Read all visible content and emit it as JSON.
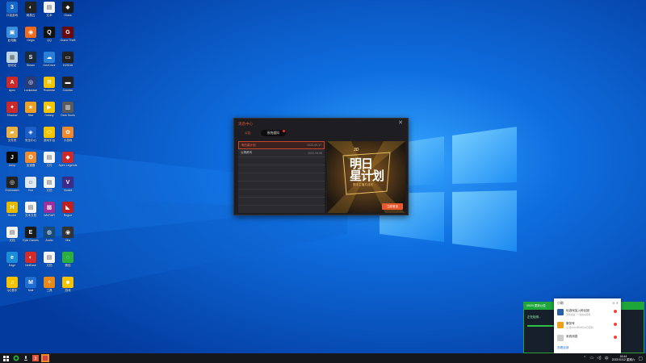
{
  "desktop_icons": [
    {
      "label": "口袋游戏",
      "color": "#1669c9",
      "glyph": "3"
    },
    {
      "label": "网易云",
      "color": "#222222",
      "glyph": "◐"
    },
    {
      "label": "文本",
      "color": "#f2f2f2",
      "glyph": "▤"
    },
    {
      "label": "Glass",
      "color": "#1a1a1a",
      "glyph": "◆"
    },
    {
      "label": "此电脑",
      "color": "#3b8edb",
      "glyph": "▣"
    },
    {
      "label": "Origin",
      "color": "#f26b1d",
      "glyph": "◉"
    },
    {
      "label": "QQ",
      "color": "#111111",
      "glyph": "Q"
    },
    {
      "label": "Grand Theft",
      "color": "#6a0a0a",
      "glyph": "G"
    },
    {
      "label": "回收站",
      "color": "#bcd4ea",
      "glyph": "▦"
    },
    {
      "label": "Steam",
      "color": "#1b2a3d",
      "glyph": "S"
    },
    {
      "label": "OneDrive",
      "color": "#2a7fd6",
      "glyph": "☁"
    },
    {
      "label": "NVIDIA",
      "color": "#222222",
      "glyph": "▭"
    },
    {
      "label": "Apex",
      "color": "#cc2a2a",
      "glyph": "A"
    },
    {
      "label": "Lockdown",
      "color": "#2a3c78",
      "glyph": "◎"
    },
    {
      "label": "Rockstar",
      "color": "#f4c400",
      "glyph": "R"
    },
    {
      "label": "Counter",
      "color": "#222222",
      "glyph": "▬"
    },
    {
      "label": "Shadow",
      "color": "#cc2a2a",
      "glyph": "✦"
    },
    {
      "label": "Star",
      "color": "#f0a020",
      "glyph": "★"
    },
    {
      "label": "Galaxy",
      "color": "#f4c400",
      "glyph": "▶"
    },
    {
      "label": "Dark Souls",
      "color": "#5a5a5a",
      "glyph": "▥"
    },
    {
      "label": "文件夹",
      "color": "#e9b143",
      "glyph": "▰"
    },
    {
      "label": "安全中心",
      "color": "#1b5ec8",
      "glyph": "◈"
    },
    {
      "label": "游戏平台",
      "color": "#f4c400",
      "glyph": "⚇"
    },
    {
      "label": "小游戏",
      "color": "#f08a2a",
      "glyph": "✿"
    },
    {
      "label": "Jump",
      "color": "#0a0a0a",
      "glyph": "J"
    },
    {
      "label": "加速器",
      "color": "#f08a2a",
      "glyph": "✪"
    },
    {
      "label": "文件",
      "color": "#f4f4f4",
      "glyph": "▤"
    },
    {
      "label": "Apex Legends",
      "color": "#cc2a2a",
      "glyph": "◆"
    },
    {
      "label": "Overwatch",
      "color": "#222222",
      "glyph": "◎"
    },
    {
      "label": "Bot",
      "color": "#dfe7f2",
      "glyph": "☺"
    },
    {
      "label": "文档",
      "color": "#f4f4f4",
      "glyph": "▤"
    },
    {
      "label": "Vivaldi",
      "color": "#3e2a88",
      "glyph": "V"
    },
    {
      "label": "Hunter",
      "color": "#e6b800",
      "glyph": "H"
    },
    {
      "label": "文本文档",
      "color": "#f4f4f4",
      "glyph": "▤"
    },
    {
      "label": "WinRAR",
      "color": "#9b2f9b",
      "glyph": "▩"
    },
    {
      "label": "Rogue",
      "color": "#c02020",
      "glyph": "◣"
    },
    {
      "label": "文档",
      "color": "#f4f4f4",
      "glyph": "▤"
    },
    {
      "label": "Epic Games",
      "color": "#1a1a1a",
      "glyph": "E"
    },
    {
      "label": "Audio",
      "color": "#184a7a",
      "glyph": "◍"
    },
    {
      "label": "Obs",
      "color": "#333333",
      "glyph": "◉"
    },
    {
      "label": "Edge",
      "color": "#1a8cd8",
      "glyph": "e"
    },
    {
      "label": "NetEase",
      "color": "#d42a2a",
      "glyph": "◐"
    },
    {
      "label": "文档",
      "color": "#f4f4f4",
      "glyph": "▤"
    },
    {
      "label": "微信",
      "color": "#2aae3d",
      "glyph": "◌"
    },
    {
      "label": "QQ音乐",
      "color": "#f4c400",
      "glyph": "♫"
    },
    {
      "label": "Mail",
      "color": "#1e6fd0",
      "glyph": "M"
    },
    {
      "label": "工具",
      "color": "#e88a1a",
      "glyph": "✧"
    },
    {
      "label": "游戏",
      "color": "#f4c400",
      "glyph": "☻"
    }
  ],
  "dialog": {
    "title": "消息中心",
    "tabs": [
      {
        "label": "公告"
      },
      {
        "label": "系统通知",
        "badge": true
      }
    ],
    "rows": [
      {
        "name": "明日星计划",
        "date": "2022-09-17",
        "highlight": true
      },
      {
        "name": "公测资讯",
        "date": "2022-09-08",
        "highlight": false
      },
      {
        "name": "",
        "date": "",
        "highlight": false
      },
      {
        "name": "",
        "date": "",
        "highlight": false
      },
      {
        "name": "",
        "date": "",
        "highlight": false
      },
      {
        "name": "",
        "date": "",
        "highlight": false
      },
      {
        "name": "",
        "date": "",
        "highlight": false
      },
      {
        "name": "",
        "date": "",
        "highlight": false
      }
    ],
    "banner": {
      "logo": "3D",
      "title_line1": "明日",
      "title_line2": "星计划",
      "subtitle": "携手主播共成长",
      "cta": "立即参加"
    }
  },
  "notify_back": {
    "header": "09/23 更新公告",
    "body": "正在检测..."
  },
  "notify": {
    "title": "小助",
    "controls": "⊖ ✕",
    "items": [
      {
        "t1": "玩游戏加入粉丝团",
        "t2": "游戏加速 · 一键启动游戏",
        "color": "#2d5fa8"
      },
      {
        "t1": "服务号",
        "t2": "[公告]2022年09月23日更新...",
        "color": "#f0a020"
      },
      {
        "t1": "系统消息",
        "t2": "",
        "color": "#cccccc"
      }
    ],
    "footer": "查看全部"
  },
  "taskbar": {
    "time": "16:44",
    "date": "2022/11/12 星期六"
  },
  "colors": {
    "accent": "#e0523b",
    "green": "#1ea63b",
    "wallpaper": "#0a5fcf"
  }
}
